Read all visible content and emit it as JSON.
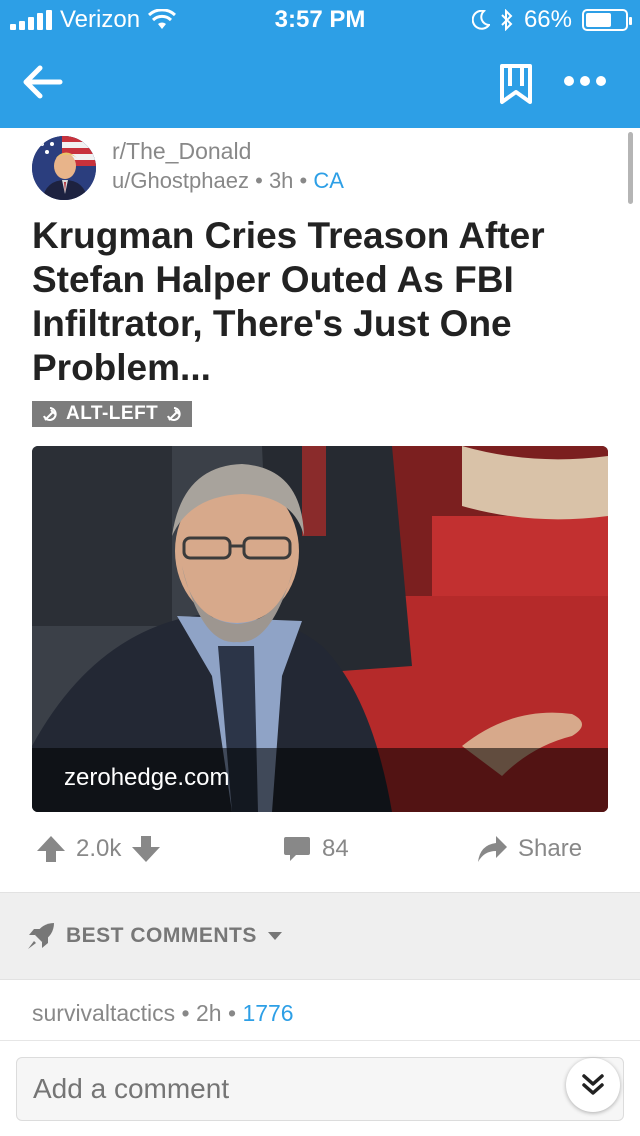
{
  "status_bar": {
    "carrier": "Verizon",
    "time": "3:57 PM",
    "battery": "66%",
    "battery_level": 0.66,
    "icons": [
      "signal-icon",
      "wifi-icon",
      "moon-icon",
      "bluetooth-icon",
      "battery-icon"
    ]
  },
  "navbar": {
    "icons": [
      "back-arrow-icon",
      "bookmark-icon",
      "more-icon"
    ],
    "color": "#2d9fe6"
  },
  "post": {
    "subreddit": "r/The_Donald",
    "author": "u/Ghostphaez",
    "age": "3h",
    "author_flair": "CA",
    "title": "Krugman Cries Treason After Stefan Halper Outed As FBI Infiltrator, There's Just One Problem...",
    "tag": "ALT-LEFT",
    "link_domain": "zerohedge.com"
  },
  "actions": {
    "score": "2.0k",
    "comments": "84",
    "share": "Share"
  },
  "comments_section": {
    "sort_label": "BEST COMMENTS"
  },
  "first_comment": {
    "author": "survivaltactics",
    "age": "2h",
    "flair": "1776"
  },
  "composer": {
    "placeholder": "Add a comment"
  },
  "colors": {
    "accent": "#2d9fe6",
    "muted_text": "#888888",
    "tag_bg": "#7c7c7c"
  }
}
